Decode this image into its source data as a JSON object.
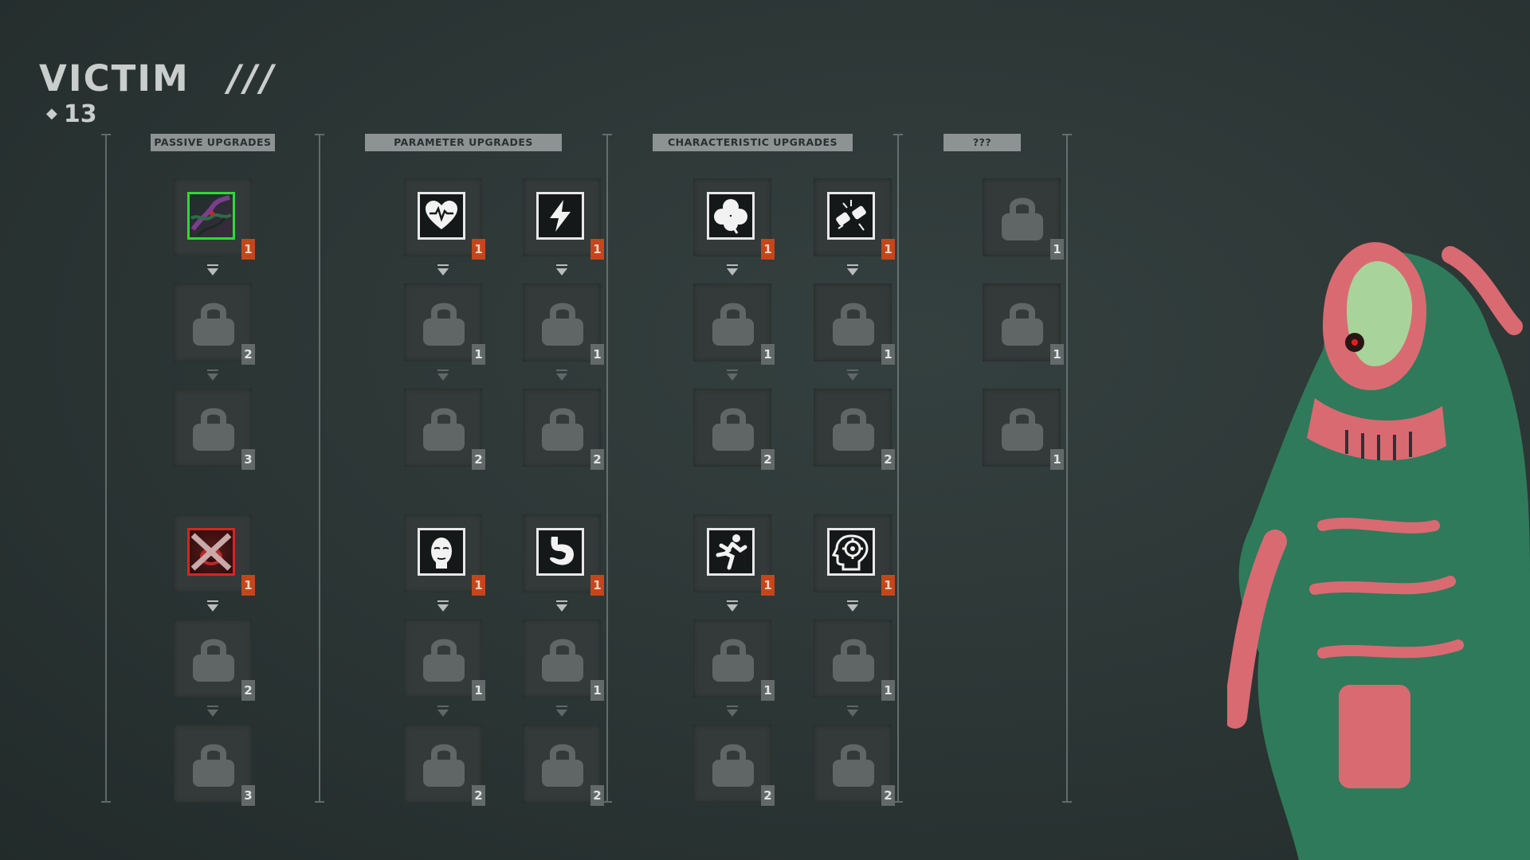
{
  "header": {
    "title": "VICTIM",
    "slashes": "///",
    "points": "13"
  },
  "columns": [
    {
      "header": "PASSIVE UPGRADES"
    },
    {
      "header": "PARAMETER UPGRADES"
    },
    {
      "header": "CHARACTERISTIC UPGRADES"
    },
    {
      "header": "???"
    }
  ],
  "tracks": [
    {
      "group": "passive",
      "icon": "green-mutation-icon",
      "levels": [
        "1",
        "2",
        "3"
      ]
    },
    {
      "group": "parameter",
      "icon": "heart-rate-icon",
      "levels": [
        "1",
        "1",
        "2"
      ]
    },
    {
      "group": "parameter",
      "icon": "lightning-icon",
      "levels": [
        "1",
        "1",
        "2"
      ]
    },
    {
      "group": "characteristic",
      "icon": "clover-icon",
      "levels": [
        "1",
        "1",
        "2"
      ]
    },
    {
      "group": "characteristic",
      "icon": "punch-icon",
      "levels": [
        "1",
        "1",
        "2"
      ]
    },
    {
      "group": "unknown",
      "icon": "lock-icon",
      "levels": [
        "1",
        "1",
        "1"
      ]
    },
    {
      "group": "passive",
      "icon": "red-mouth-icon",
      "levels": [
        "1",
        "2",
        "3"
      ]
    },
    {
      "group": "parameter",
      "icon": "face-icon",
      "levels": [
        "1",
        "1",
        "2"
      ]
    },
    {
      "group": "parameter",
      "icon": "stomach-icon",
      "levels": [
        "1",
        "1",
        "2"
      ]
    },
    {
      "group": "characteristic",
      "icon": "running-icon",
      "levels": [
        "1",
        "1",
        "2"
      ]
    },
    {
      "group": "characteristic",
      "icon": "brain-gear-icon",
      "levels": [
        "1",
        "1",
        "2"
      ]
    }
  ],
  "colors": {
    "active_level": "#c4461a",
    "locked_level": "#626968",
    "header_bg": "#8d9392"
  }
}
